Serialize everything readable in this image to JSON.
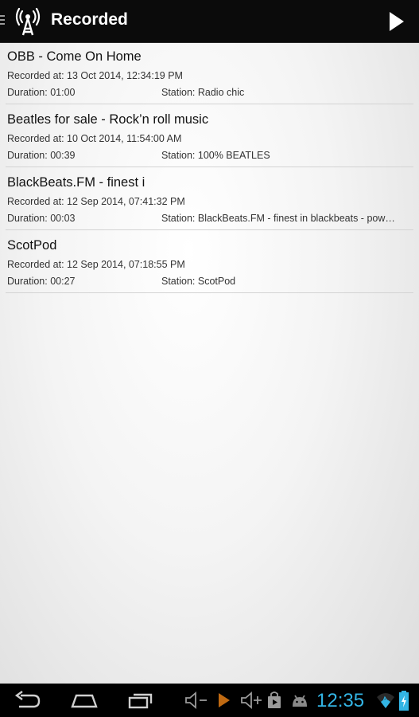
{
  "actionbar": {
    "title": "Recorded"
  },
  "recordings": [
    {
      "title": "OBB - Come On Home",
      "recorded": "Recorded at: 13 Oct 2014, 12:34:19 PM",
      "duration": "Duration: 01:00",
      "station": "Station: Radio chic"
    },
    {
      "title": "Beatles for sale - Rock’n roll music",
      "recorded": "Recorded at: 10 Oct 2014, 11:54:00 AM",
      "duration": "Duration: 00:39",
      "station": "Station: 100% BEATLES"
    },
    {
      "title": "BlackBeats.FM - finest i",
      "recorded": "Recorded at: 12 Sep 2014, 07:41:32 PM",
      "duration": "Duration: 00:03",
      "station": "Station: BlackBeats.FM - finest in blackbeats - pow…"
    },
    {
      "title": "ScotPod",
      "recorded": "Recorded at: 12 Sep 2014, 07:18:55 PM",
      "duration": "Duration: 00:27",
      "station": "Station: ScotPod"
    }
  ],
  "statusbar": {
    "clock": "12:35"
  },
  "colors": {
    "accent": "#33b5e5",
    "actionbar": "#0b0b0b"
  },
  "icons": {
    "app": "radio-tower-icon",
    "play": "play-icon",
    "back": "back-icon",
    "home": "home-icon",
    "recents": "recent-apps-icon"
  }
}
